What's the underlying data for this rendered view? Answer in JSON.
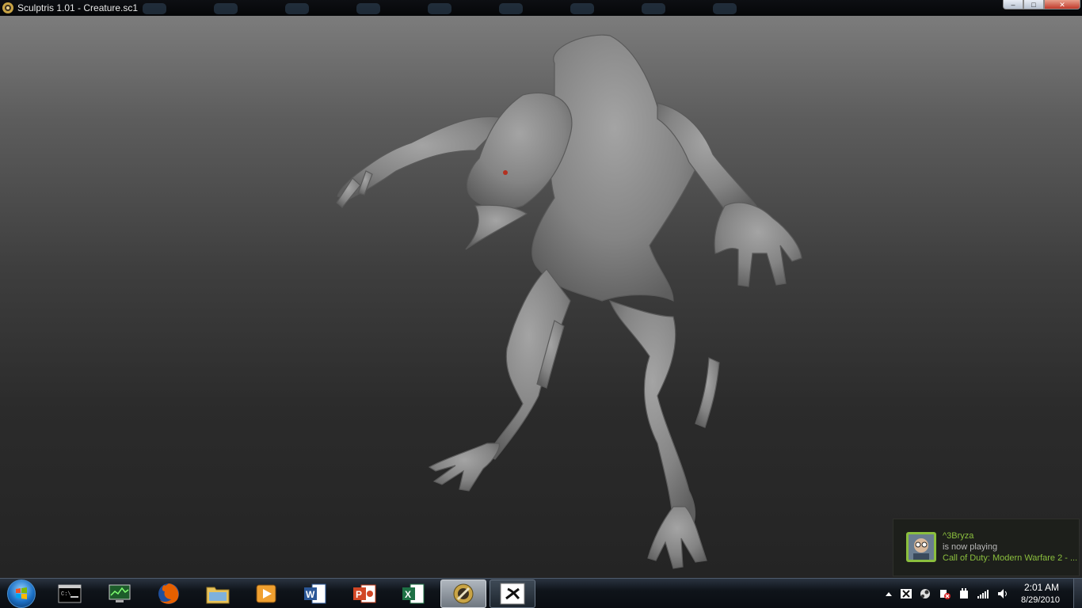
{
  "window": {
    "title": "Sculptris 1.01 - Creature.sc1",
    "buttons": {
      "minimize": "–",
      "maximize": "□",
      "close": "✕"
    }
  },
  "viewport": {
    "background_top": "#7c7c7c",
    "background_bottom": "#242424",
    "model_color": "#8a8a8a"
  },
  "notification": {
    "name": "^3Bryza",
    "message": "is now playing",
    "game": "Call of Duty: Modern Warfare 2 - ...",
    "accent": "#8bbf3e"
  },
  "taskbar": {
    "start_icon": "windows-orb-icon",
    "apps": [
      {
        "name": "command-prompt",
        "icon": "cmd-icon",
        "state": "normal"
      },
      {
        "name": "task-manager",
        "icon": "monitor-icon",
        "state": "normal"
      },
      {
        "name": "firefox",
        "icon": "firefox-icon",
        "state": "normal"
      },
      {
        "name": "explorer",
        "icon": "folder-icon",
        "state": "normal"
      },
      {
        "name": "media-player",
        "icon": "play-icon",
        "state": "normal"
      },
      {
        "name": "word",
        "icon": "word-icon",
        "state": "normal"
      },
      {
        "name": "powerpoint",
        "icon": "powerpoint-icon",
        "state": "normal"
      },
      {
        "name": "excel",
        "icon": "excel-icon",
        "state": "normal"
      },
      {
        "name": "sculptris",
        "icon": "sculptris-icon",
        "state": "active"
      },
      {
        "name": "xfire",
        "icon": "xfire-icon",
        "state": "open"
      }
    ],
    "tray": {
      "time": "2:01 AM",
      "date": "8/29/2010",
      "icons": [
        "show-hidden-icon",
        "xfire-tray-icon",
        "steam-icon",
        "action-center-icon",
        "power-icon",
        "network-icon",
        "volume-icon"
      ]
    }
  }
}
